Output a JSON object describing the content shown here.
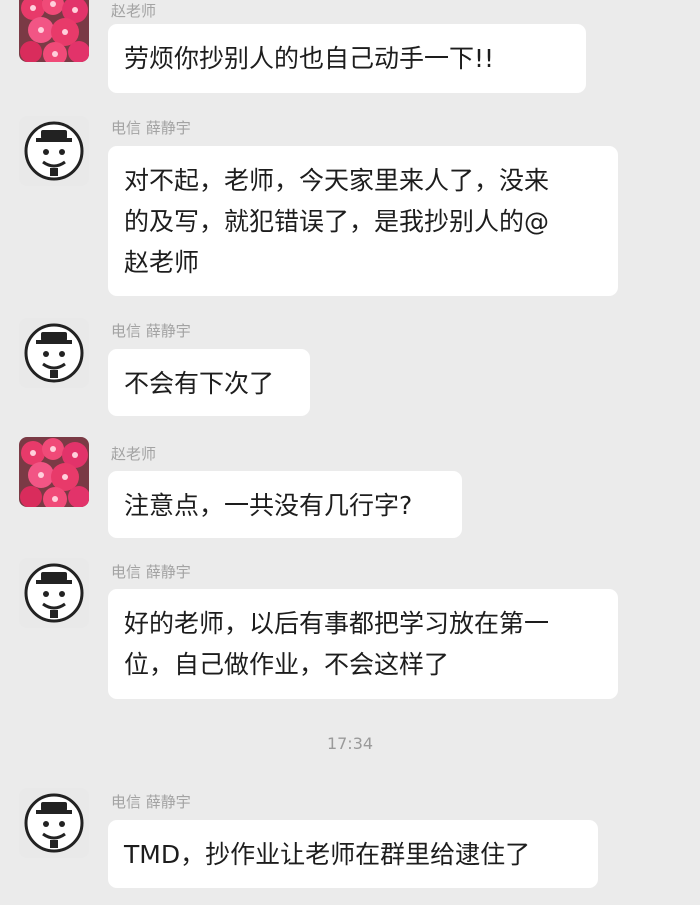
{
  "conversation": {
    "timestamp": "17:34",
    "messages": [
      {
        "sender": "赵老师",
        "avatar": "flower-avatar",
        "lines": [
          "劳烦你抄别人的也自己动手一下!!"
        ]
      },
      {
        "sender": "电信 薛静宇",
        "avatar": "cartoon-face-avatar",
        "lines": [
          "对不起，老师，今天家里来人了，没来",
          "的及写，就犯错误了，是我抄别人的@",
          "赵老师"
        ]
      },
      {
        "sender": "电信 薛静宇",
        "avatar": "cartoon-face-avatar",
        "lines": [
          "不会有下次了"
        ]
      },
      {
        "sender": "赵老师",
        "avatar": "flower-avatar",
        "lines": [
          "注意点，一共没有几行字?"
        ]
      },
      {
        "sender": "电信 薛静宇",
        "avatar": "cartoon-face-avatar",
        "lines": [
          "好的老师，以后有事都把学习放在第一",
          "位，自己做作业，不会这样了"
        ]
      },
      {
        "sender": "电信 薛静宇",
        "avatar": "cartoon-face-avatar",
        "lines": [
          "TMD，抄作业让老师在群里给逮住了"
        ]
      }
    ]
  }
}
